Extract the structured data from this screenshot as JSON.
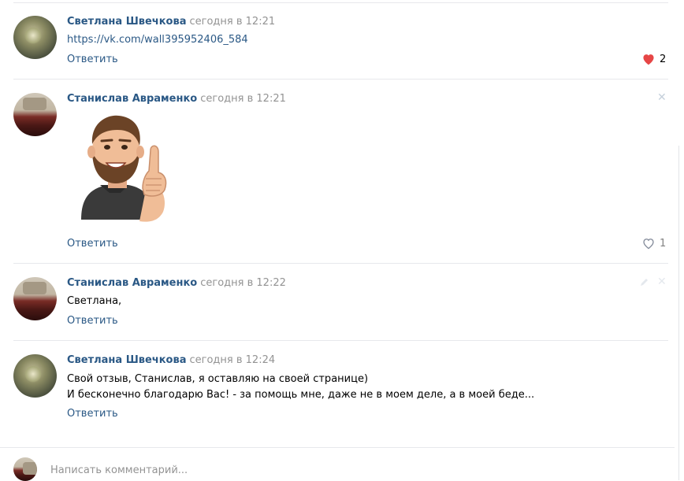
{
  "comments": [
    {
      "author": "Светлана Швечкова",
      "date": "сегодня в 12:21",
      "text": "https://vk.com/wall395952406_584",
      "reply_label": "Ответить",
      "likes": "2",
      "liked": true
    },
    {
      "author": "Станислав Авраменко",
      "date": "сегодня в 12:21",
      "sticker": "thumbs-up-bearded-man-sticker",
      "reply_label": "Ответить",
      "likes": "1",
      "liked": false
    },
    {
      "author": "Станислав Авраменко",
      "date": "сегодня в 12:22",
      "text": "Светлана,",
      "reply_label": "Ответить"
    },
    {
      "author": "Светлана Швечкова",
      "date": "сегодня в 12:24",
      "lines": [
        "Свой отзыв, Станислав, я оставляю на своей странице)",
        "И бесконечно благодарю Вас! - за помощь мне, даже не в моем деле, а в моей беде..."
      ],
      "reply_label": "Ответить"
    }
  ],
  "composer": {
    "placeholder": "Написать комментарий..."
  },
  "colors": {
    "link": "#2a5885",
    "meta": "#939393",
    "like_active": "#e64646",
    "separator": "#e7e8ec"
  },
  "icons": [
    "heart-filled-icon",
    "heart-outline-icon",
    "close-icon",
    "edit-icon"
  ]
}
